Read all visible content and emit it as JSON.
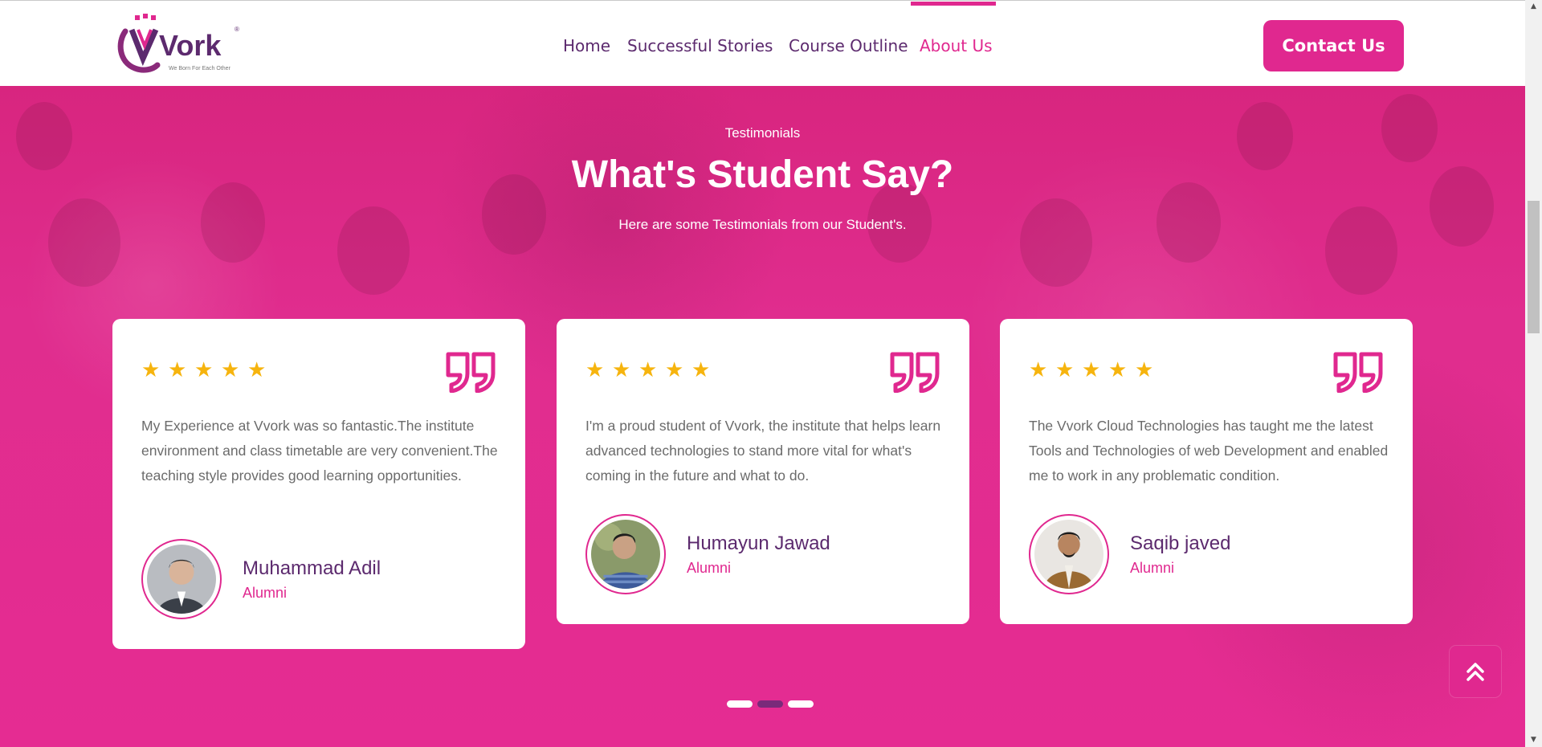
{
  "brand": {
    "logo_text": "Vork",
    "tagline": "We Born For Each Other"
  },
  "nav": {
    "items": [
      {
        "label": "Home"
      },
      {
        "label": "Successful Stories"
      },
      {
        "label": "Course Outline"
      },
      {
        "label": "About Us",
        "active": true
      }
    ],
    "contact_label": "Contact Us"
  },
  "section": {
    "eyebrow": "Testimonials",
    "title": "What's Student Say?",
    "subtitle": "Here are some Testimonials from our Student's."
  },
  "testimonials": [
    {
      "rating": 5,
      "text": "My Experience at Vvork was so fantastic.The institute environment and class timetable are very convenient.The teaching style provides good learning opportunities.",
      "name": "Muhammad Adil",
      "role": "Alumni"
    },
    {
      "rating": 5,
      "text": "I'm a proud student of Vvork, the institute that helps learn advanced technologies to stand more vital for what's coming in the future and what to do.",
      "name": "Humayun Jawad",
      "role": "Alumni"
    },
    {
      "rating": 5,
      "text": "The Vvork Cloud Technologies has taught me the latest Tools and Technologies of web Development and enabled me to work in any problematic condition.",
      "name": "Saqib javed",
      "role": "Alumni"
    }
  ],
  "carousel": {
    "active_index": 1,
    "count": 3
  },
  "colors": {
    "brand_pink": "#e0288f",
    "brand_purple": "#5c2a6e",
    "star": "#f6b40e"
  },
  "icons": {
    "star": "star-icon",
    "quote": "quote-icon",
    "back_to_top": "double-chevron-up-icon"
  }
}
